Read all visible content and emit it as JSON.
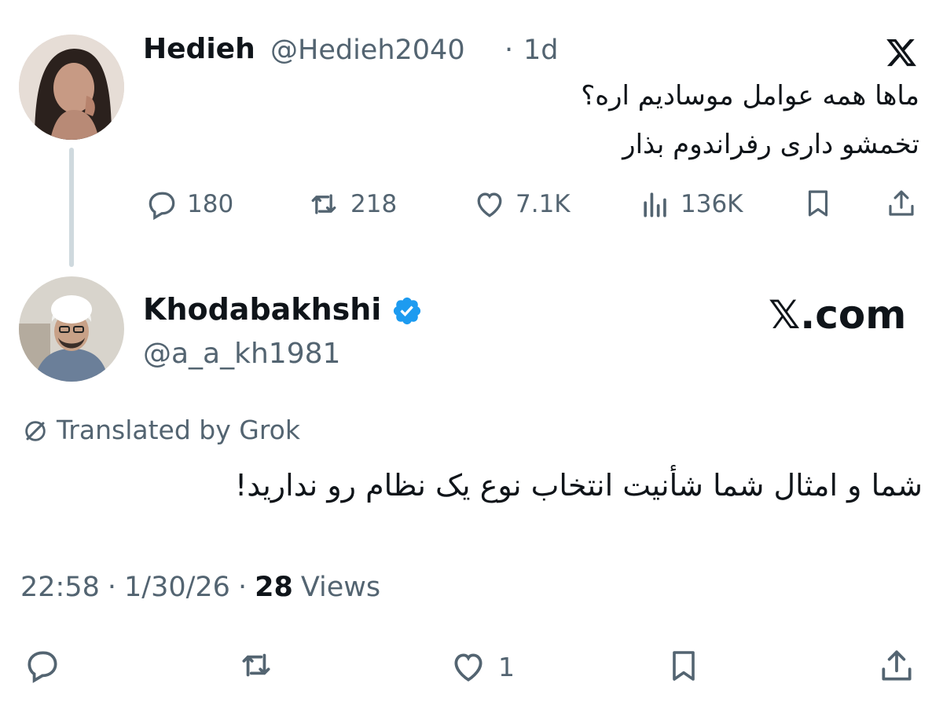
{
  "original_tweet": {
    "display_name": "Hedieh",
    "handle": "@Hedieh2040",
    "time_ago": "1d",
    "separator": "·",
    "text_line1": "ماها همه عوامل موسادیم اره؟",
    "text_line2": "تخمشو داری رفراندوم بذار",
    "replies": "180",
    "reposts": "218",
    "likes": "7.1K",
    "views": "136K",
    "icons": [
      "x-logo-icon",
      "reply-icon",
      "repost-icon",
      "like-icon",
      "views-icon",
      "bookmark-icon",
      "share-icon"
    ]
  },
  "reply_tweet": {
    "display_name": "Khodabakhshi",
    "handle": "@a_a_kh1981",
    "verified_color": "#1d9bf0",
    "watermark": "𝕏.com",
    "translated_label": "Translated by Grok",
    "text": "شما و امثال شما شأنیت انتخاب نوع یک نظام رو ندارید!",
    "time": "22:58",
    "date": "1/30/26",
    "separator": "·",
    "views_count": "28",
    "views_label": "Views",
    "likes": "1"
  },
  "colors": {
    "text_primary": "#0f1419",
    "text_muted": "#536471",
    "thread_line": "#cfd9de",
    "verified_blue": "#1d9bf0"
  }
}
